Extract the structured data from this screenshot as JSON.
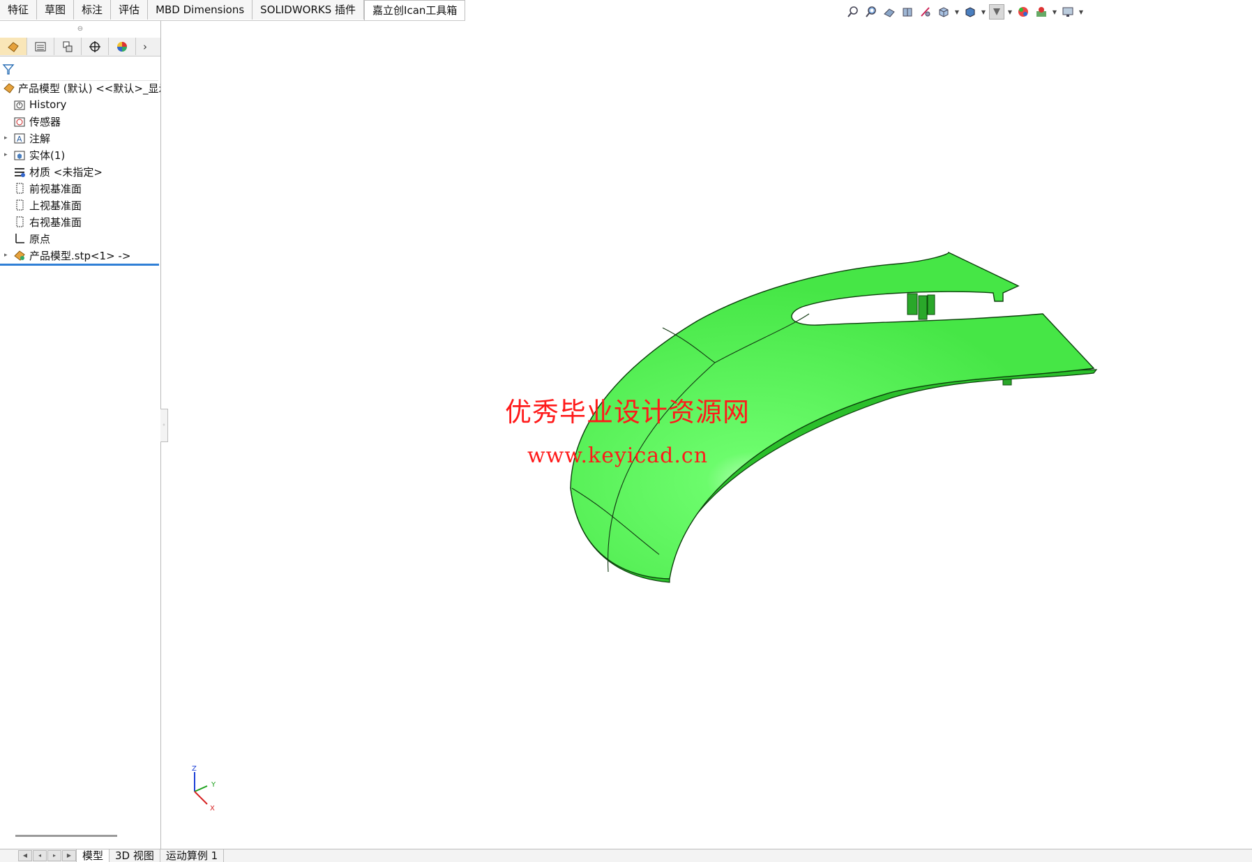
{
  "command_tabs": [
    {
      "label": "特征"
    },
    {
      "label": "草图"
    },
    {
      "label": "标注"
    },
    {
      "label": "评估"
    },
    {
      "label": "MBD Dimensions"
    },
    {
      "label": "SOLIDWORKS 插件"
    },
    {
      "label": "嘉立创Ican工具箱"
    }
  ],
  "hud_icons": [
    "zoom-to-fit-icon",
    "zoom-area-icon",
    "previous-view-icon",
    "section-view-icon",
    "dynamic-annotation-icon",
    "view-orientation-icon",
    "display-style-icon",
    "hide-show-items-icon",
    "edit-appearance-icon",
    "apply-scene-icon",
    "view-settings-icon"
  ],
  "tree": {
    "root": "产品模型 (默认) <<默认>_显示",
    "items": [
      {
        "label": "History",
        "icon": "history-icon",
        "expandable": false
      },
      {
        "label": "传感器",
        "icon": "sensors-icon",
        "expandable": false
      },
      {
        "label": "注解",
        "icon": "annotations-icon",
        "expandable": true
      },
      {
        "label": "实体(1)",
        "icon": "solid-bodies-icon",
        "expandable": true
      },
      {
        "label": "材质 <未指定>",
        "icon": "material-icon",
        "expandable": false
      },
      {
        "label": "前视基准面",
        "icon": "plane-icon",
        "expandable": false
      },
      {
        "label": "上视基准面",
        "icon": "plane-icon",
        "expandable": false
      },
      {
        "label": "右视基准面",
        "icon": "plane-icon",
        "expandable": false
      },
      {
        "label": "原点",
        "icon": "origin-icon",
        "expandable": false
      },
      {
        "label": "产品模型.stp<1> ->",
        "icon": "imported-feature-icon",
        "expandable": true
      }
    ]
  },
  "bottom_tabs": [
    {
      "label": "模型"
    },
    {
      "label": "3D 视图"
    },
    {
      "label": "运动算例 1"
    }
  ],
  "watermark": {
    "title": "优秀毕业设计资源网",
    "url": "www.keyicad.cn"
  },
  "triad": {
    "z": "Z",
    "y": "Y",
    "x": "X"
  },
  "colors": {
    "model_green": "#55f555",
    "model_dark": "#1a8a1a",
    "watermark_red": "#ff1a1a",
    "selection_blue": "#2f7fd6"
  }
}
